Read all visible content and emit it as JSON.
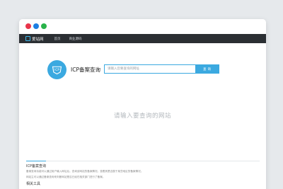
{
  "colors": {
    "dot_red": "#e8344a",
    "dot_blue": "#1d7fe3",
    "dot_green": "#29b34a",
    "accent": "#3ba9e0",
    "navbar": "#2b2f33"
  },
  "navbar": {
    "logo_text": "爱站网",
    "links": [
      {
        "label": "首页"
      },
      {
        "label": "商业源码"
      }
    ]
  },
  "search": {
    "badge_text": "ICP",
    "title": "ICP备案查询",
    "placeholder": "请输入您要查询的网址",
    "button_label": "查询"
  },
  "main": {
    "empty_hint": "请输入要查询的网站"
  },
  "info": {
    "title": "ICP备案查询",
    "lines": [
      "备案查询功能可以通过用户输入网址后，查询该网站的备案情况。查看其是否属于某些地区的备案情况。",
      "网站主可以通过备案查询来判断网站是否已经在相关部门进行了备案。"
    ],
    "subtitle": "相关工具"
  }
}
